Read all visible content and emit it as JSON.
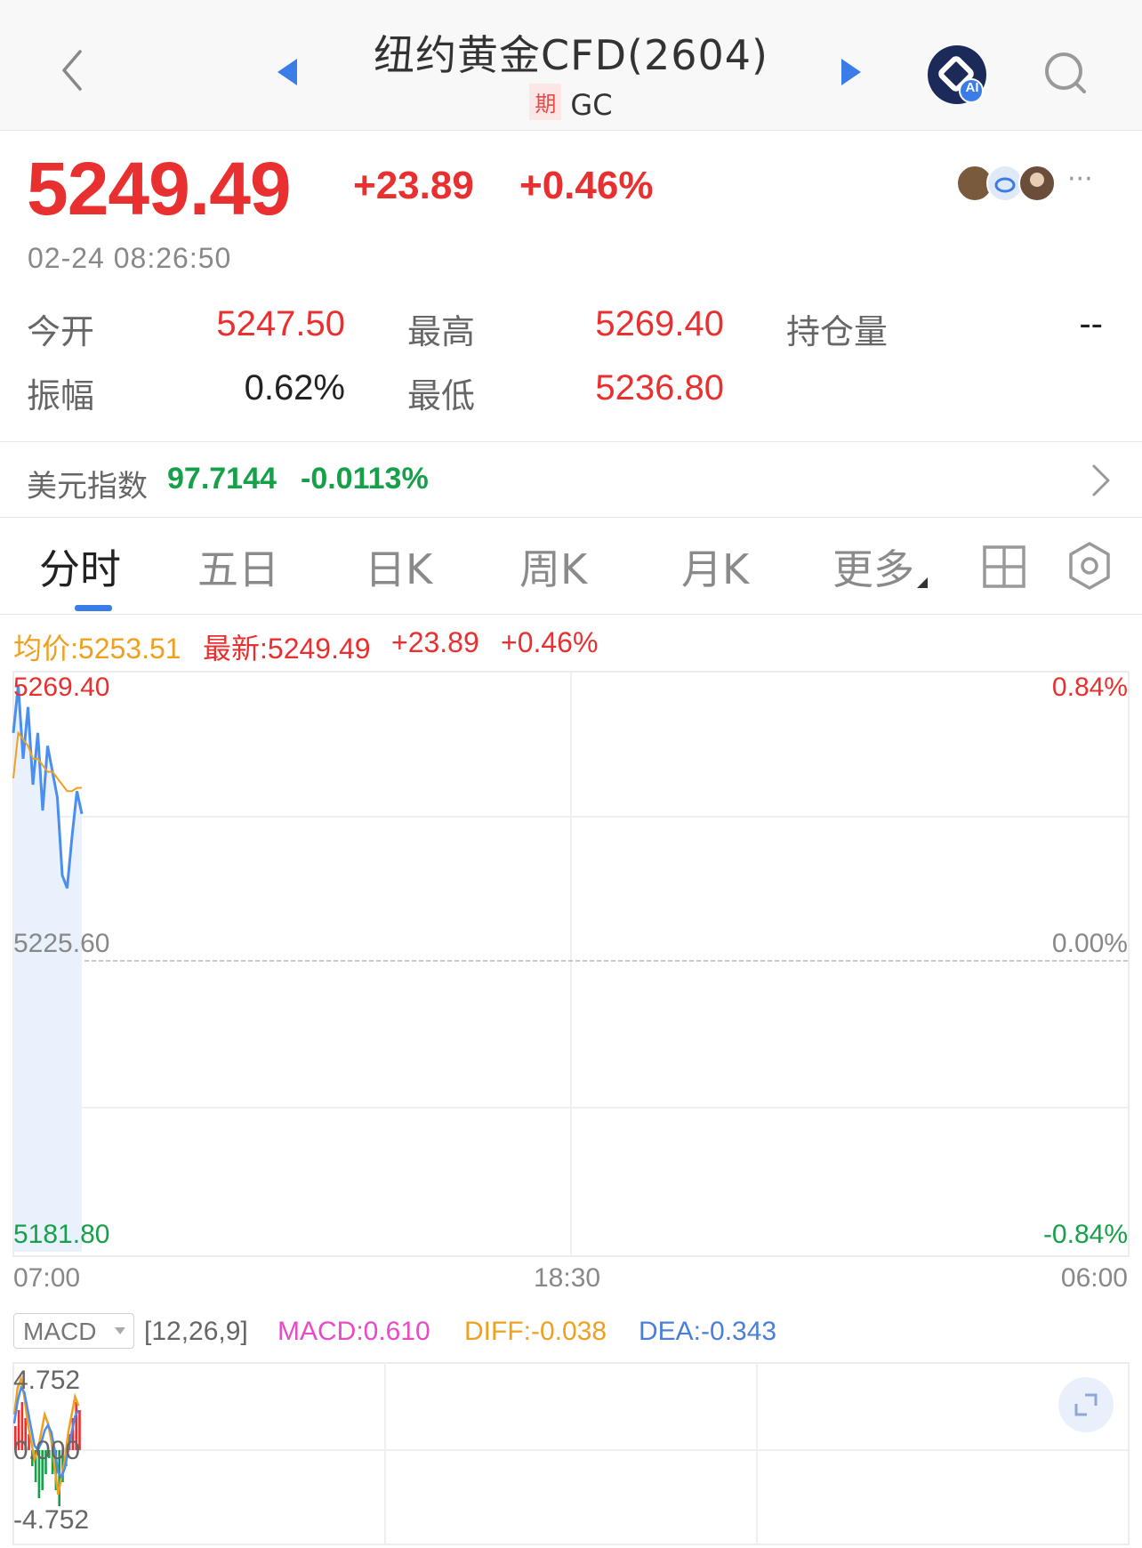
{
  "header": {
    "title": "纽约黄金CFD(2604)",
    "tag": "期",
    "code": "GC",
    "ai_badge": "AI"
  },
  "quote": {
    "price": "5249.49",
    "change": "+23.89",
    "change_pct": "+0.46%",
    "timestamp": "02-24 08:26:50",
    "more": "···"
  },
  "stats": {
    "open_label": "今开",
    "open_value": "5247.50",
    "high_label": "最高",
    "high_value": "5269.40",
    "oi_label": "持仓量",
    "oi_value": "--",
    "amp_label": "振幅",
    "amp_value": "0.62%",
    "low_label": "最低",
    "low_value": "5236.80"
  },
  "dollar_index": {
    "label": "美元指数",
    "value": "97.7144",
    "change_pct": "-0.0113%"
  },
  "tabs": [
    {
      "label": "分时",
      "active": true
    },
    {
      "label": "五日"
    },
    {
      "label": "日K"
    },
    {
      "label": "周K"
    },
    {
      "label": "月K"
    },
    {
      "label": "更多"
    }
  ],
  "info_line": {
    "avg": "均价:5253.51",
    "latest": "最新:5249.49",
    "change": "+23.89",
    "change_pct": "+0.46%"
  },
  "price_chart": {
    "y_top": "5269.40",
    "y_mid": "5225.60",
    "y_bottom": "5181.80",
    "pct_top": "0.84%",
    "pct_mid": "0.00%",
    "pct_bottom": "-0.84%",
    "x_labels": [
      "07:00",
      "18:30",
      "06:00"
    ]
  },
  "macd": {
    "selector": "MACD",
    "params": "[12,26,9]",
    "macd": "MACD:0.610",
    "diff": "DIFF:-0.038",
    "dea": "DEA:-0.343",
    "y_top": "4.752",
    "y_mid": "0.000",
    "y_bottom": "-4.752"
  },
  "colors": {
    "up": "#e93030",
    "down": "#16a04a",
    "price_line": "#4a8ef0",
    "avg_line": "#f0a020",
    "accent": "#3a7ce8"
  },
  "chart_data": {
    "type": "line",
    "series": [
      {
        "name": "最新",
        "values": [
          5262,
          5269.4,
          5258,
          5266,
          5254,
          5262,
          5250,
          5260,
          5256,
          5252,
          5240,
          5238,
          5246,
          5253,
          5249.49
        ]
      },
      {
        "name": "均价",
        "values": [
          5255,
          5262,
          5261,
          5260,
          5258,
          5258,
          5257,
          5256,
          5256,
          5255,
          5254,
          5253,
          5253,
          5253.5,
          5253.51
        ]
      }
    ],
    "ylim": [
      5181.8,
      5269.4
    ]
  }
}
